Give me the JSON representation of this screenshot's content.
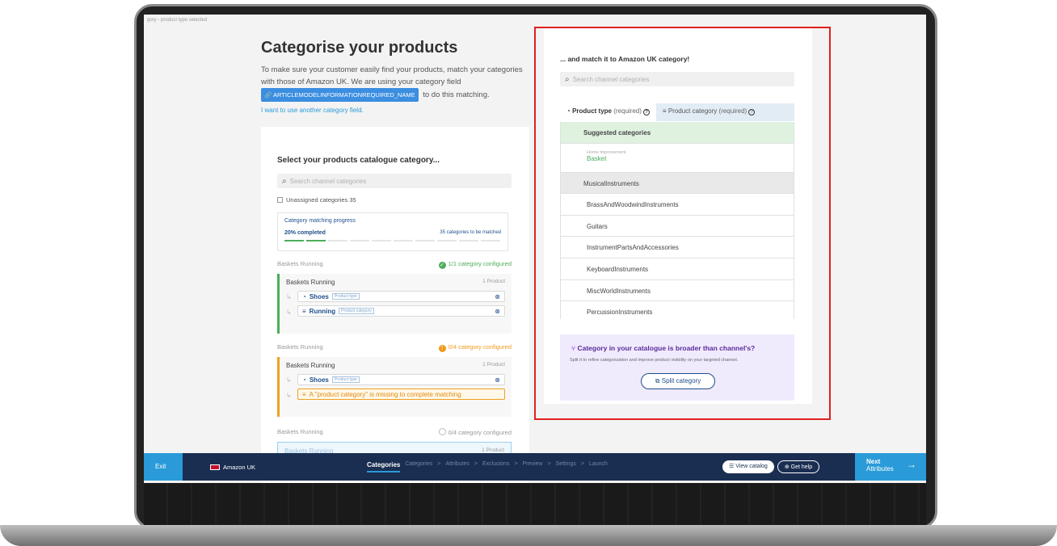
{
  "header": {
    "crumb": "gory - product type selected",
    "title": "Categorise your products",
    "desc_1": "To make sure your customer easily find your products, match your categories with those of Amazon UK. We are using your category field",
    "field_name": "ARTICLEMODELINFORMATIONREQUIRED_NAME",
    "desc_2": "to do this matching.",
    "other_field_link": "I want to use another category field."
  },
  "left_panel": {
    "title": "Select your products catalogue category...",
    "search_placeholder": "Search channel categories",
    "unassigned": "Unassigned categories 35",
    "progress": {
      "title": "Category matching progress",
      "completed_label": "20% completed",
      "completed_fraction": 0.2,
      "remaining_label": "35 categories to be matched"
    },
    "groups": [
      {
        "label": "Baskets Running",
        "status": "1/1 category configured",
        "card_title": "Baskets Running",
        "card_count": "1 Product",
        "rows": [
          {
            "name": "Shoes",
            "tag": "Product type"
          },
          {
            "name": "Running",
            "tag": "Product category"
          }
        ]
      },
      {
        "label": "Baskets Running",
        "status": "0/4 category configured",
        "card_title": "Baskets Running",
        "card_count": "1 Product",
        "rows": [
          {
            "name": "Shoes",
            "tag": "Product type"
          }
        ],
        "missing": "A \"product category\" is missing to complete matching"
      },
      {
        "label": "Baskets Running",
        "status": "0/4 category configured",
        "card_title": "Baskets Running",
        "card_count": "1 Product"
      }
    ]
  },
  "right_panel": {
    "title": "... and match it to Amazon UK category!",
    "search_placeholder": "Search channel categories",
    "tabs": [
      {
        "label": "Product type",
        "req": "(required)"
      },
      {
        "label": "Product category",
        "req": "(required)"
      }
    ],
    "suggested_header": "Suggested categories",
    "suggested_path": "Home Improvement",
    "suggested_name": "Basket",
    "section": "MusicalInstruments",
    "items": [
      "BrassAndWoodwindInstruments",
      "Guitars",
      "InstrumentPartsAndAccessories",
      "KeyboardInstruments",
      "MiscWorldInstruments",
      "PercussionInstruments"
    ],
    "split": {
      "title": "Category in your catalogue is broader than channel's?",
      "desc": "Split it to refine categorization and improve product visibility on your targeted channel.",
      "button": "Split category"
    }
  },
  "bottom_bar": {
    "exit": "Exit",
    "channel": "Amazon UK",
    "current_step": "Categories",
    "steps": [
      "Categories",
      ">",
      "Attributes",
      ">",
      "Exclusions",
      ">",
      "Preview",
      ">",
      "Settings",
      ">",
      "Launch"
    ],
    "view_catalog": "View catalog",
    "get_help": "Get help",
    "next_label": "Next",
    "next_sub": "Attributes"
  },
  "colors": {
    "accent": "#2a9bd8",
    "navy": "#1a2e52",
    "success": "#4cae5a",
    "warning": "#f0a020",
    "highlight": "#e02020"
  }
}
